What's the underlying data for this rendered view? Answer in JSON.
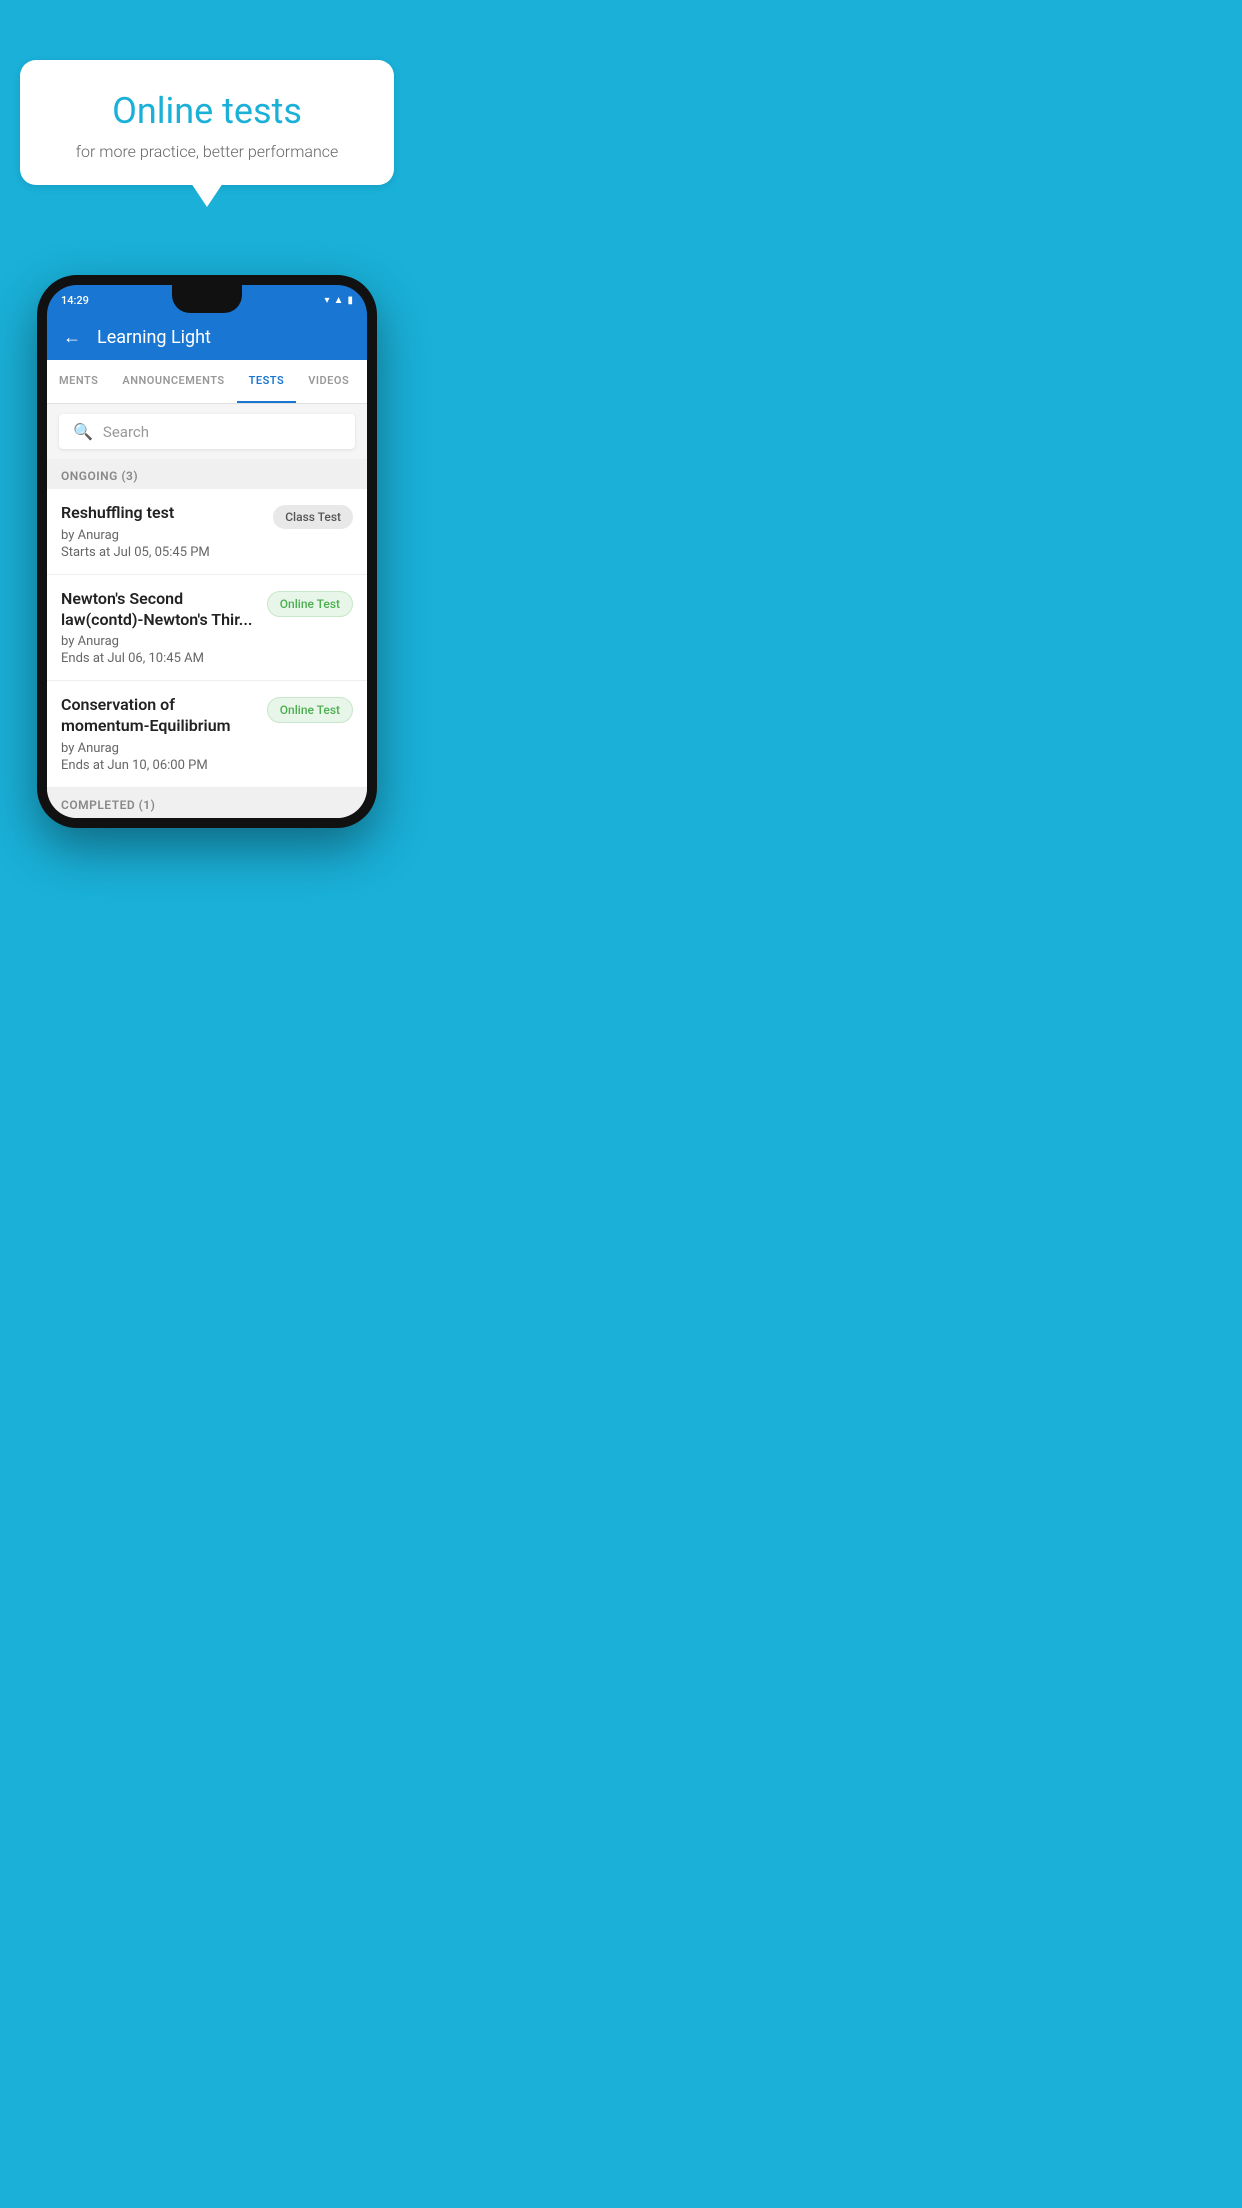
{
  "background_color": "#1ab0d8",
  "bubble": {
    "title": "Online tests",
    "subtitle": "for more practice, better performance"
  },
  "phone": {
    "status": {
      "time": "14:29"
    },
    "header": {
      "title": "Learning Light",
      "back_label": "←"
    },
    "tabs": [
      {
        "label": "MENTS",
        "active": false
      },
      {
        "label": "ANNOUNCEMENTS",
        "active": false
      },
      {
        "label": "TESTS",
        "active": true
      },
      {
        "label": "VIDEOS",
        "active": false
      }
    ],
    "search": {
      "placeholder": "Search"
    },
    "ongoing_section": {
      "label": "ONGOING (3)"
    },
    "tests": [
      {
        "name": "Reshuffling test",
        "by": "by Anurag",
        "time": "Starts at  Jul 05, 05:45 PM",
        "badge": "Class Test",
        "badge_type": "gray"
      },
      {
        "name": "Newton's Second law(contd)-Newton's Thir...",
        "by": "by Anurag",
        "time": "Ends at  Jul 06, 10:45 AM",
        "badge": "Online Test",
        "badge_type": "green"
      },
      {
        "name": "Conservation of momentum-Equilibrium",
        "by": "by Anurag",
        "time": "Ends at  Jun 10, 06:00 PM",
        "badge": "Online Test",
        "badge_type": "green"
      }
    ],
    "completed_section": {
      "label": "COMPLETED (1)"
    }
  }
}
